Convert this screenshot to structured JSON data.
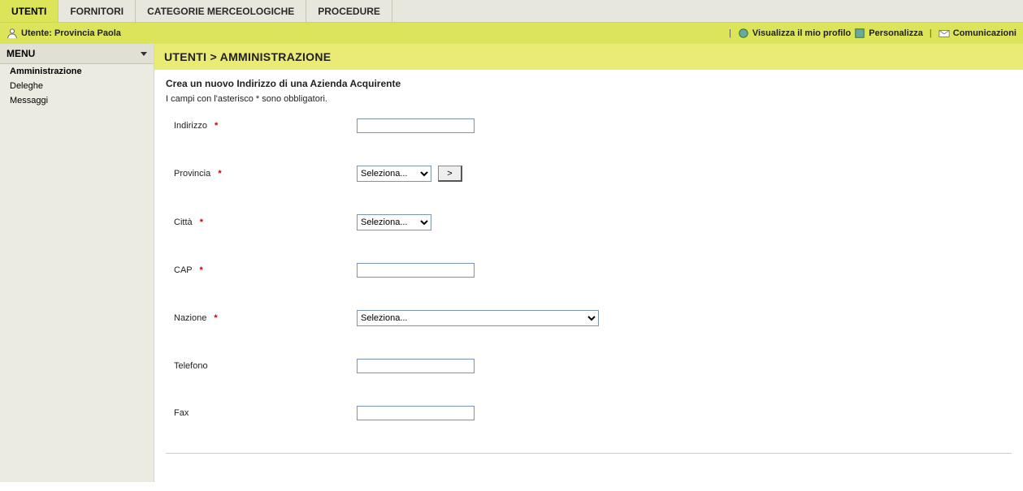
{
  "tabs": [
    {
      "label": "UTENTI",
      "active": true
    },
    {
      "label": "FORNITORI",
      "active": false
    },
    {
      "label": "CATEGORIE MERCEOLOGICHE",
      "active": false
    },
    {
      "label": "PROCEDURE",
      "active": false
    }
  ],
  "userbar": {
    "user_label": "Utente: Provincia Paola",
    "links": {
      "profile": "Visualizza il mio profilo",
      "personalize": "Personalizza",
      "comms": "Comunicazioni"
    }
  },
  "sidebar": {
    "header": "MENU",
    "items": [
      {
        "label": "Amministrazione",
        "active": true
      },
      {
        "label": "Deleghe",
        "active": false
      },
      {
        "label": "Messaggi",
        "active": false
      }
    ]
  },
  "breadcrumb": "UTENTI  >  AMMINISTRAZIONE",
  "form": {
    "title": "Crea un nuovo Indirizzo di una Azienda Acquirente",
    "hint": "I campi con l'asterisco * sono obbligatori.",
    "required_mark": "*",
    "go_button": ">",
    "placeholder": "Seleziona...",
    "fields": {
      "indirizzo": {
        "label": "Indirizzo",
        "required": true,
        "value": ""
      },
      "provincia": {
        "label": "Provincia",
        "required": true,
        "value": "Seleziona..."
      },
      "citta": {
        "label": "Città",
        "required": true,
        "value": "Seleziona..."
      },
      "cap": {
        "label": "CAP",
        "required": true,
        "value": ""
      },
      "nazione": {
        "label": "Nazione",
        "required": true,
        "value": "Seleziona..."
      },
      "telefono": {
        "label": "Telefono",
        "required": false,
        "value": ""
      },
      "fax": {
        "label": "Fax",
        "required": false,
        "value": ""
      }
    }
  }
}
